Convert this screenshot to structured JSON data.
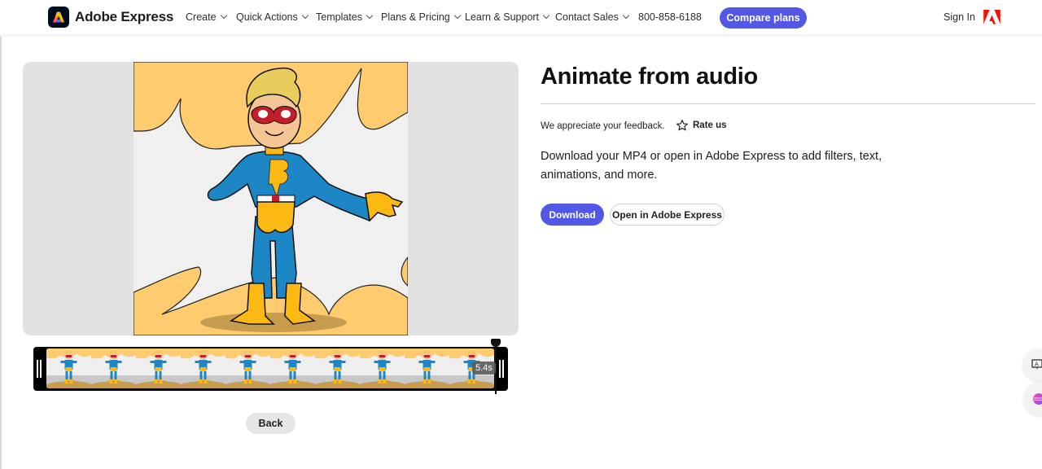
{
  "header": {
    "brand_name": "Adobe Express",
    "nav_items": [
      {
        "label": "Create"
      },
      {
        "label": "Quick Actions"
      },
      {
        "label": "Templates"
      },
      {
        "label": "Plans & Pricing"
      },
      {
        "label": "Learn & Support"
      },
      {
        "label": "Contact Sales"
      }
    ],
    "phone": "800-858-6188",
    "compare_label": "Compare plans",
    "signin_label": "Sign In"
  },
  "preview": {
    "duration": "5.4s",
    "frame_count": 10,
    "back_label": "Back"
  },
  "panel": {
    "title": "Animate from audio",
    "feedback_text": "We appreciate your feedback.",
    "rate_label": "Rate us",
    "description": "Download your MP4 or open in Adobe Express to add filters, text, animations, and more.",
    "download_label": "Download",
    "open_label": "Open in Adobe Express"
  },
  "colors": {
    "accent": "#5258e4",
    "adobe_red": "#fa0f00",
    "preview_bg": "#e2e2e2",
    "scene_orange": "#fecb6e"
  }
}
